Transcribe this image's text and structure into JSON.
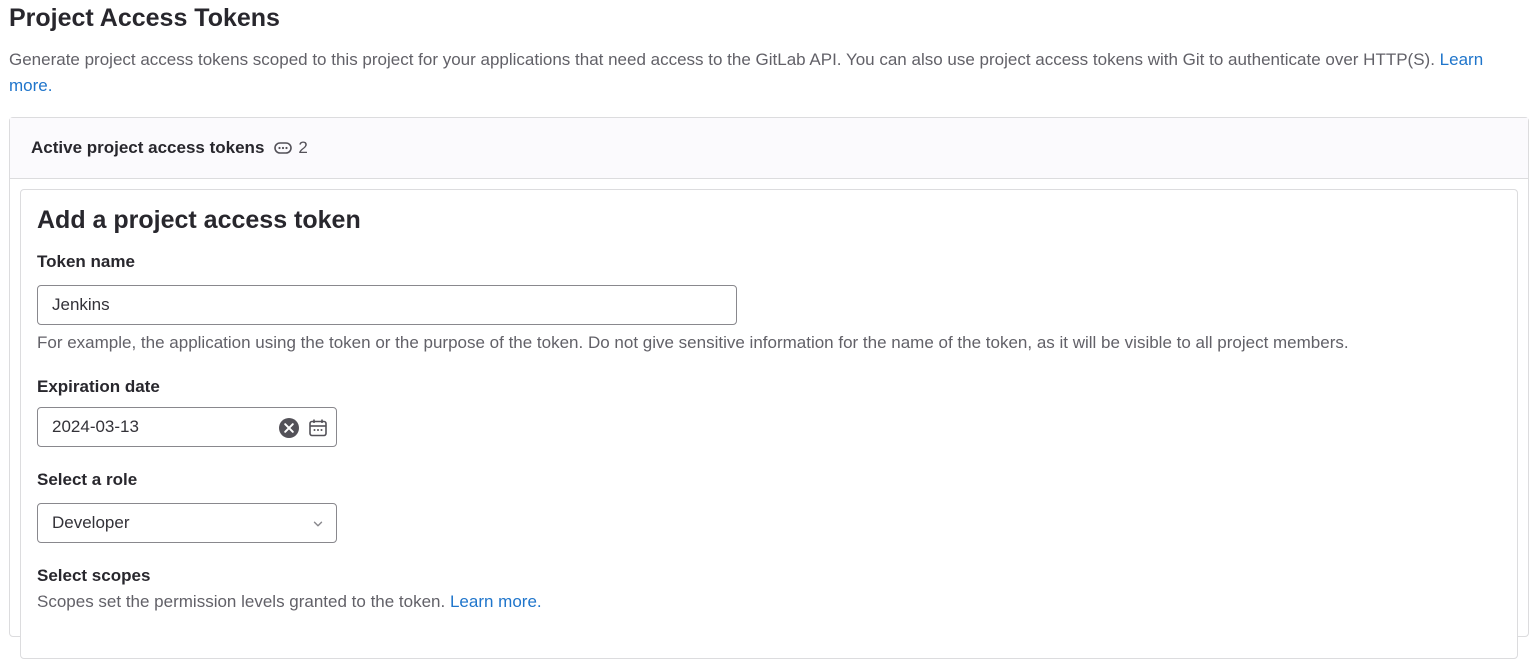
{
  "page": {
    "title": "Project Access Tokens",
    "description": "Generate project access tokens scoped to this project for your applications that need access to the GitLab API. You can also use project access tokens with Git to authenticate over HTTP(S).",
    "learn_more": "Learn more."
  },
  "active_tokens": {
    "title": "Active project access tokens",
    "count": "2",
    "icon": "token-icon"
  },
  "form": {
    "title": "Add a project access token",
    "token_name": {
      "label": "Token name",
      "value": "Jenkins",
      "help": "For example, the application using the token or the purpose of the token. Do not give sensitive information for the name of the token, as it will be visible to all project members."
    },
    "expiration": {
      "label": "Expiration date",
      "value": "2024-03-13",
      "clear_icon": "clear-icon",
      "calendar_icon": "calendar-icon"
    },
    "role": {
      "label": "Select a role",
      "value": "Developer",
      "icon": "chevron-down-icon"
    },
    "scopes": {
      "label": "Select scopes",
      "help": "Scopes set the permission levels granted to the token.",
      "learn_more": "Learn more."
    }
  },
  "colors": {
    "link": "#1f75cb",
    "border": "#dcdcde",
    "input_border": "#89888d",
    "text": "#333238",
    "muted": "#626168"
  }
}
